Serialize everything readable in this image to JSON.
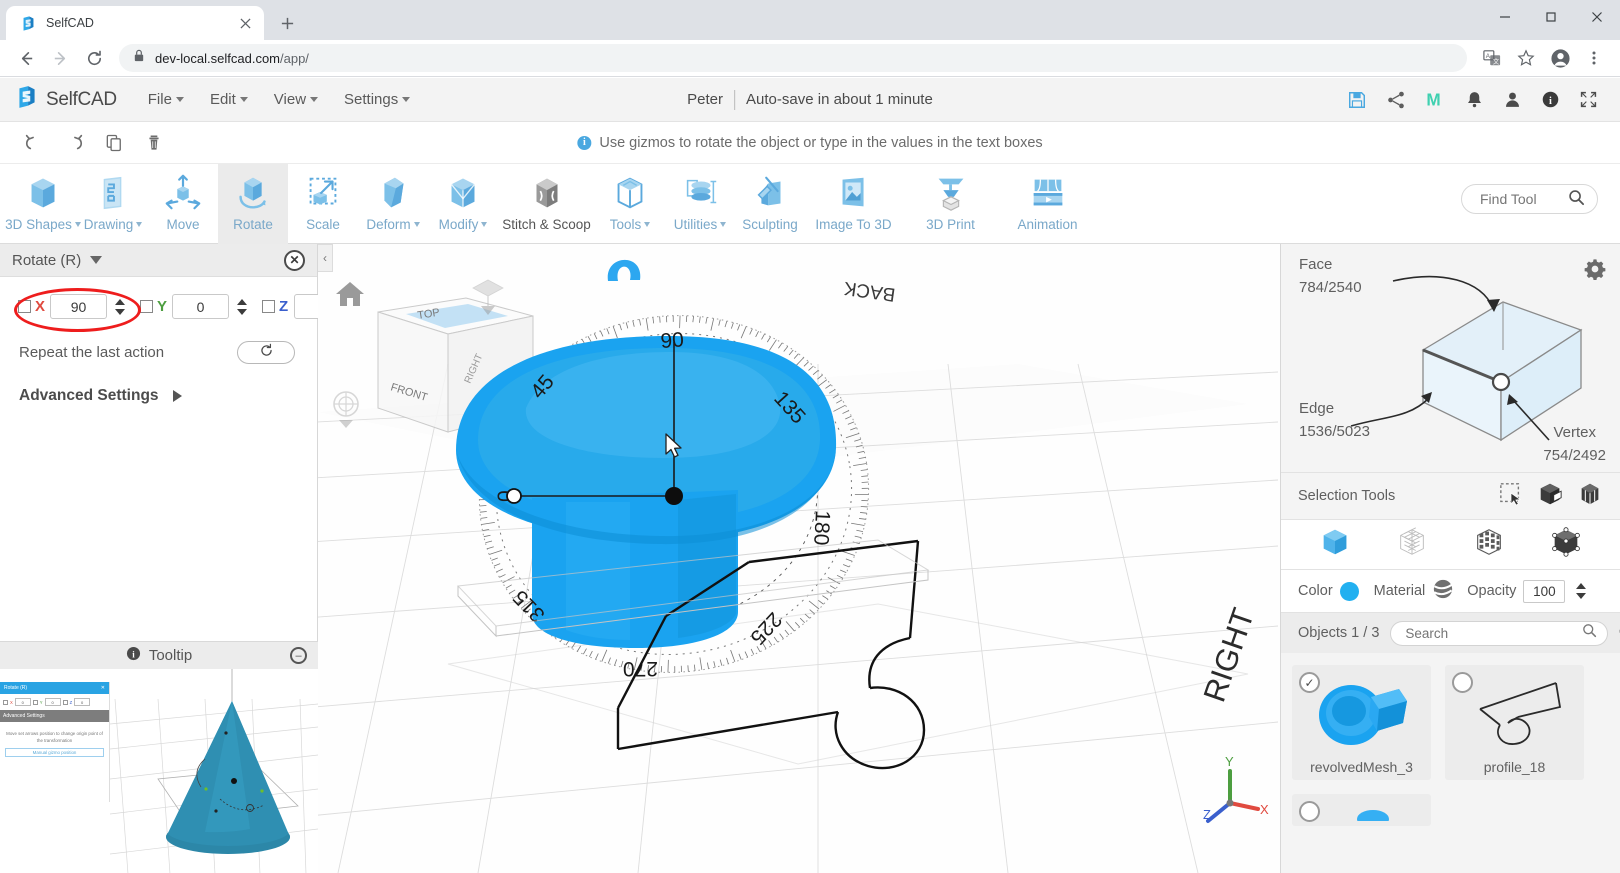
{
  "browser": {
    "tab_title": "SelfCAD",
    "tab_favicon_icon": "selfcad-logo-icon",
    "new_tab_icon": "plus-icon",
    "close_tab_icon": "close-icon",
    "window_minimize_icon": "minimize-icon",
    "window_maximize_icon": "maximize-icon",
    "window_close_icon": "close-icon",
    "back_icon": "arrow-left-icon",
    "forward_icon": "arrow-right-icon",
    "reload_icon": "reload-icon",
    "lock_icon": "lock-icon",
    "url_domain": "dev-local.selfcad.com",
    "url_path": "/app/",
    "translate_icon": "translate-icon",
    "bookmark_icon": "star-icon",
    "profile_icon": "account-icon",
    "menu_icon": "kebab-menu-icon"
  },
  "app_header": {
    "brand": "SelfCAD",
    "brand_icon": "selfcad-logo-icon",
    "menus": [
      {
        "label": "File",
        "has_caret": true
      },
      {
        "label": "Edit",
        "has_caret": true
      },
      {
        "label": "View",
        "has_caret": true
      },
      {
        "label": "Settings",
        "has_caret": true
      }
    ],
    "user_name": "Peter",
    "autosave_text": "Auto-save in about 1 minute",
    "icons": [
      {
        "name": "save-icon",
        "color": "#4aa8e0"
      },
      {
        "name": "share-icon",
        "color": "#6b6b6b"
      },
      {
        "name": "mailchimp-m-icon",
        "color": "#3fd0b0"
      },
      {
        "name": "notifications-bell-icon",
        "color": "#5a5a5a"
      },
      {
        "name": "user-account-icon",
        "color": "#5a5a5a"
      },
      {
        "name": "info-icon",
        "color": "#3a3a3a"
      },
      {
        "name": "fullscreen-icon",
        "color": "#5a5a5a"
      }
    ]
  },
  "subbar": {
    "undo_icon": "undo-icon",
    "redo_icon": "redo-icon",
    "copy_icon": "copy-icon",
    "delete_icon": "trash-icon",
    "hint_text": "Use gizmos to rotate the object or type in the values in the text boxes",
    "hint_icon": "info-icon"
  },
  "ribbon": {
    "tools": [
      {
        "label": "3D Shapes",
        "icon": "cube-icon",
        "caret": true,
        "active": false,
        "dark": false
      },
      {
        "label": "Drawing",
        "icon": "drawing-icon",
        "caret": true,
        "active": false,
        "dark": false
      },
      {
        "label": "Move",
        "icon": "move-icon",
        "caret": false,
        "active": false,
        "dark": false
      },
      {
        "label": "Rotate",
        "icon": "rotate-icon",
        "caret": false,
        "active": true,
        "dark": false
      },
      {
        "label": "Scale",
        "icon": "scale-icon",
        "caret": false,
        "active": false,
        "dark": false
      },
      {
        "label": "Deform",
        "icon": "deform-icon",
        "caret": true,
        "active": false,
        "dark": false
      },
      {
        "label": "Modify",
        "icon": "modify-icon",
        "caret": true,
        "active": false,
        "dark": false
      },
      {
        "label": "Stitch & Scoop",
        "icon": "stitch-scoop-icon",
        "caret": false,
        "active": false,
        "dark": true
      },
      {
        "label": "Tools",
        "icon": "tools-icon",
        "caret": true,
        "active": false,
        "dark": false
      },
      {
        "label": "Utilities",
        "icon": "utilities-icon",
        "caret": true,
        "active": false,
        "dark": false
      },
      {
        "label": "Sculpting",
        "icon": "sculpting-icon",
        "caret": false,
        "active": false,
        "dark": false
      },
      {
        "label": "Image To 3D",
        "icon": "image-to-3d-icon",
        "caret": false,
        "active": false,
        "dark": false
      },
      {
        "label": "3D Print",
        "icon": "3d-print-icon",
        "caret": false,
        "active": false,
        "dark": false
      },
      {
        "label": "Animation",
        "icon": "animation-icon",
        "caret": false,
        "active": false,
        "dark": false
      }
    ],
    "find_tool_label": "Find Tool",
    "find_tool_icon": "search-icon"
  },
  "rotate_panel": {
    "title": "Rotate (R)",
    "collapse_icon": "chevron-down-icon",
    "close_icon": "close-icon",
    "axes": [
      {
        "label": "X",
        "value": "90",
        "checked": false,
        "color": "#e04a3f"
      },
      {
        "label": "Y",
        "value": "0",
        "checked": false,
        "color": "#4d9e40"
      },
      {
        "label": "Z",
        "value": "0",
        "checked": false,
        "color": "#3a5fcd"
      }
    ],
    "repeat_label": "Repeat the last action",
    "repeat_icon": "refresh-icon",
    "advanced_label": "Advanced Settings",
    "advanced_icon": "chevron-right-icon",
    "annotation_shape": "red-ellipse-highlight"
  },
  "tooltip_panel": {
    "title": "Tooltip",
    "info_icon": "info-icon",
    "minimize_icon": "minus-circle-icon",
    "preview": {
      "mini_title": "Rotate (R)",
      "mini_axes": [
        {
          "label": "X",
          "value": "0"
        },
        {
          "label": "Y",
          "value": "0"
        },
        {
          "label": "Z",
          "value": "0"
        }
      ],
      "mini_advanced": "Advanced Settings",
      "mini_help": "Move set arrows position to change origin point of the transformation",
      "mini_button": "Manual gizmo position"
    }
  },
  "viewport": {
    "collapse_icon": "chevron-left-icon",
    "home_icon": "home-icon",
    "orbit_icon": "orbit-compass-icon",
    "view_cube": {
      "top_face": "TOP",
      "front_face": "FRONT",
      "right_face": "RIGHT"
    },
    "ground_labels": {
      "back": "BACK",
      "right": "RIGHT"
    },
    "protractor_ticks": [
      "0",
      "45",
      "90",
      "135",
      "180",
      "225",
      "270",
      "315"
    ],
    "axis_gizmo": {
      "x": "X",
      "y": "Y",
      "z": "Z",
      "x_color": "#e04a3f",
      "y_color": "#4d9e40",
      "z_color": "#3a5fcd"
    },
    "model_color": "#1aa3f0",
    "cursor_icon": "mouse-pointer-icon"
  },
  "right_panel": {
    "gear_icon": "gear-icon",
    "geometry": {
      "face_label": "Face",
      "face_value": "784/2540",
      "edge_label": "Edge",
      "edge_value": "1536/5023",
      "vertex_label": "Vertex",
      "vertex_value": "754/2492"
    },
    "selection_tools_label": "Selection Tools",
    "selection_tool_icons": [
      "rectangle-select-icon",
      "box-select-icon",
      "lasso-select-icon"
    ],
    "mode_icons": [
      "solid-view-icon",
      "wireframe-view-icon",
      "mesh-view-icon",
      "vertex-view-icon"
    ],
    "color_label": "Color",
    "color_value": "#22b0f0",
    "material_label": "Material",
    "material_icon": "material-sphere-icon",
    "opacity_label": "Opacity",
    "opacity_value": "100",
    "objects_count_label": "Objects 1 / 3",
    "objects_search_placeholder": "Search",
    "objects_search_icon": "search-icon",
    "objects_gear_icon": "gear-icon",
    "objects": [
      {
        "name": "revolvedMesh_3",
        "selected": true,
        "thumb": "blue-revolved-knob"
      },
      {
        "name": "profile_18",
        "selected": false,
        "thumb": "black-profile-curve"
      },
      {
        "name": "",
        "selected": false,
        "thumb": "blue-partial"
      }
    ]
  }
}
